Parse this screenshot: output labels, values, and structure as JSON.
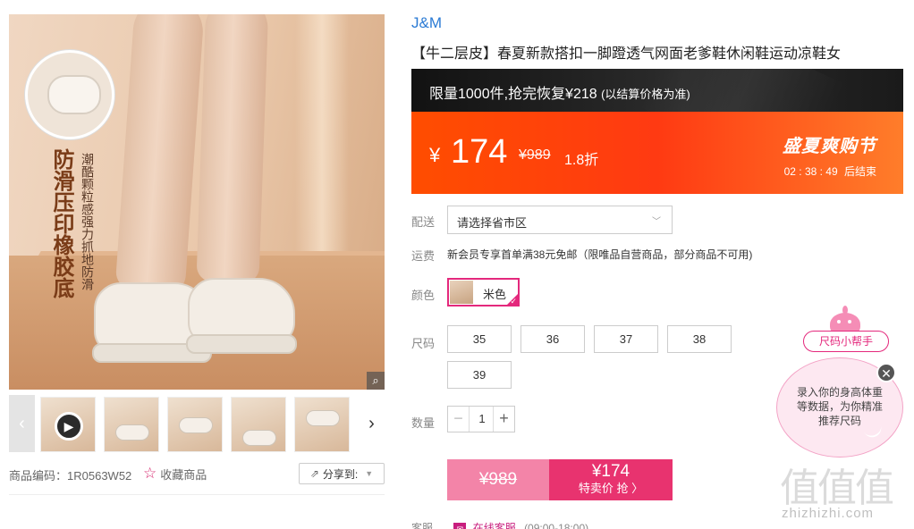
{
  "gallery": {
    "feature_title": "防滑压印橡胶底",
    "feature_subtitle": "潮酷颗粒感强力抓地防滑",
    "zoom_icon": "magnifier-icon",
    "thumb_count": 6
  },
  "product_meta": {
    "code_label": "商品编码：",
    "code": "1R0563W52",
    "favorite_label": "收藏商品",
    "share_label": "分享到:"
  },
  "product": {
    "brand": "J&M",
    "title": "【牛二层皮】春夏新款搭扣一脚蹬透气网面老爹鞋休闲鞋运动凉鞋女"
  },
  "promo": {
    "limit_text": "限量1000件,抢完恢复¥218",
    "limit_note": "(以结算价格为准)",
    "currency": "¥",
    "price": "174",
    "original_price": "¥989",
    "discount": "1.8折",
    "event_name": "盛夏爽购节",
    "countdown": "02 : 38 : 49",
    "countdown_suffix": "后结束",
    "colors": {
      "banner_start": "#ff4d00",
      "banner_end": "#ff7d2a",
      "accent": "#e4287c"
    }
  },
  "delivery": {
    "label": "配送",
    "placeholder": "请选择省市区"
  },
  "freight": {
    "label": "运费",
    "text": "新会员专享首单满38元免邮（限唯品自营商品，部分商品不可用)"
  },
  "color": {
    "label": "颜色",
    "selected": "米色"
  },
  "size": {
    "label": "尺码",
    "options": [
      "35",
      "36",
      "37",
      "38",
      "39"
    ]
  },
  "quantity": {
    "label": "数量",
    "minus": "−",
    "value": "1",
    "plus": "+"
  },
  "buy": {
    "original_price": "¥989",
    "price": "¥174",
    "action_label": "特卖价 抢 〉"
  },
  "service": {
    "label": "客服",
    "online": "在线客服",
    "hours": "(09:00-18:00)"
  },
  "size_helper": {
    "button_label": "尺码小帮手",
    "tip": "录入你的身高体重等数据，为你精准推荐尺码",
    "close": "✕"
  },
  "watermark": {
    "logo": "值值值",
    "url": "zhizhizhi.com"
  }
}
